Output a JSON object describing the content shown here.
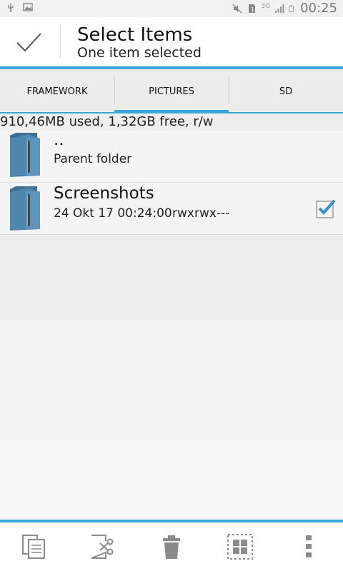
{
  "status_bar": {
    "time": "00:25",
    "network": "3G",
    "icons": [
      "usb-icon",
      "gallery-icon",
      "mute-icon",
      "sim-icon",
      "network-icon",
      "signal-icon",
      "battery-icon"
    ]
  },
  "action_mode": {
    "title": "Select Items",
    "subtitle": "One item selected"
  },
  "tabs": [
    {
      "label": "FRAMEWORK",
      "active": false
    },
    {
      "label": "PICTURES",
      "active": true
    },
    {
      "label": "SD",
      "active": false
    }
  ],
  "storage_info": "910,46MB used, 1,32GB free, r/w",
  "files": [
    {
      "name": "..",
      "detail": "Parent folder",
      "icon": "folder-icon",
      "selected": false
    },
    {
      "name": "Screenshots",
      "date": "24 Okt 17 00:24:00",
      "permissions": "rwxrwx---",
      "icon": "folder-icon",
      "selected": true
    }
  ],
  "bottom_actions": [
    "copy-icon",
    "cut-icon",
    "delete-icon",
    "select-all-icon",
    "overflow-menu-icon"
  ],
  "colors": {
    "accent": "#3aa7d9",
    "folder": "#4a7fa8"
  }
}
